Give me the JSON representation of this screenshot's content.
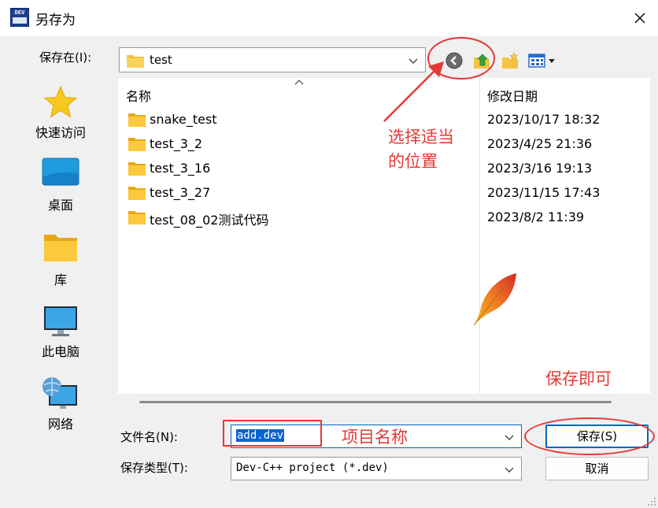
{
  "window": {
    "title": "另存为",
    "app_icon_text": "DEV",
    "close_icon": "close-icon"
  },
  "toolbar": {
    "save_in_label": "保存在(I):",
    "current_folder": "test",
    "icons": [
      "back-icon",
      "up-folder-icon",
      "new-folder-icon",
      "view-menu-icon"
    ]
  },
  "places": [
    {
      "label": "快速访问",
      "icon": "star-icon"
    },
    {
      "label": "桌面",
      "icon": "desktop-icon"
    },
    {
      "label": "库",
      "icon": "library-folder-icon"
    },
    {
      "label": "此电脑",
      "icon": "computer-icon"
    },
    {
      "label": "网络",
      "icon": "network-icon"
    }
  ],
  "file_list": {
    "columns": [
      "名称",
      "修改日期"
    ],
    "rows": [
      {
        "name": "snake_test",
        "date": "2023/10/17 18:32"
      },
      {
        "name": "test_3_2",
        "date": "2023/4/25 21:36"
      },
      {
        "name": "test_3_16",
        "date": "2023/3/16 19:13"
      },
      {
        "name": "test_3_27",
        "date": "2023/11/15 17:43"
      },
      {
        "name": "test_08_02测试代码",
        "date": "2023/8/2 11:39"
      }
    ]
  },
  "form": {
    "filename_label": "文件名(N):",
    "filename_value": "add.dev",
    "filetype_label": "保存类型(T):",
    "filetype_value": "Dev-C++ project (*.dev)",
    "save_button": "保存(S)",
    "cancel_button": "取消"
  },
  "annotations": {
    "location_line1": "选择适当",
    "location_line2": "的位置",
    "project_name": "项目名称",
    "save_hint": "保存即可"
  },
  "colors": {
    "annotation": "#e53935",
    "folder": "#f5c342",
    "selection": "#0a64d2",
    "default_button_border": "#0067c0"
  }
}
